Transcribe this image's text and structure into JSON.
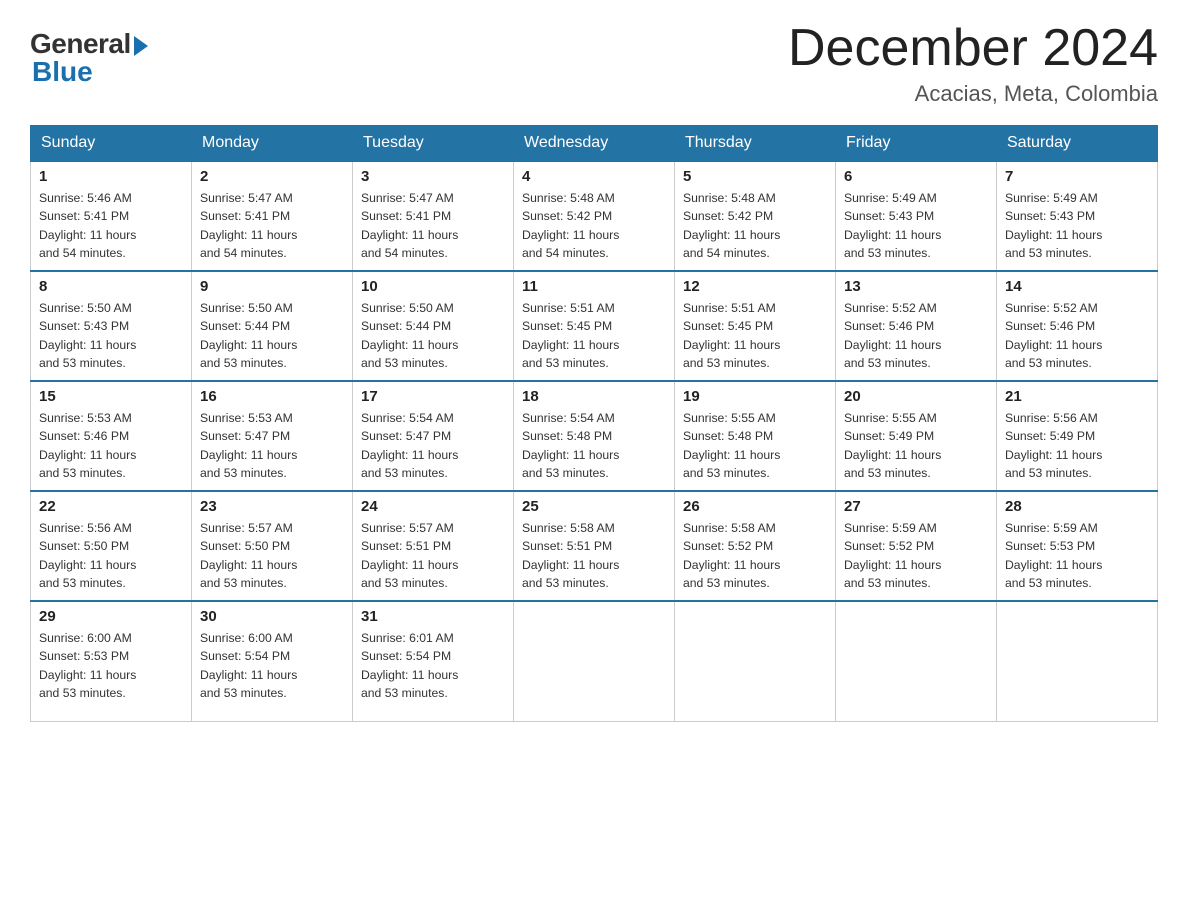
{
  "logo": {
    "general": "General",
    "blue": "Blue"
  },
  "header": {
    "month": "December 2024",
    "location": "Acacias, Meta, Colombia"
  },
  "days_of_week": [
    "Sunday",
    "Monday",
    "Tuesday",
    "Wednesday",
    "Thursday",
    "Friday",
    "Saturday"
  ],
  "weeks": [
    [
      {
        "day": "1",
        "sunrise": "5:46 AM",
        "sunset": "5:41 PM",
        "daylight": "11 hours and 54 minutes."
      },
      {
        "day": "2",
        "sunrise": "5:47 AM",
        "sunset": "5:41 PM",
        "daylight": "11 hours and 54 minutes."
      },
      {
        "day": "3",
        "sunrise": "5:47 AM",
        "sunset": "5:41 PM",
        "daylight": "11 hours and 54 minutes."
      },
      {
        "day": "4",
        "sunrise": "5:48 AM",
        "sunset": "5:42 PM",
        "daylight": "11 hours and 54 minutes."
      },
      {
        "day": "5",
        "sunrise": "5:48 AM",
        "sunset": "5:42 PM",
        "daylight": "11 hours and 54 minutes."
      },
      {
        "day": "6",
        "sunrise": "5:49 AM",
        "sunset": "5:43 PM",
        "daylight": "11 hours and 53 minutes."
      },
      {
        "day": "7",
        "sunrise": "5:49 AM",
        "sunset": "5:43 PM",
        "daylight": "11 hours and 53 minutes."
      }
    ],
    [
      {
        "day": "8",
        "sunrise": "5:50 AM",
        "sunset": "5:43 PM",
        "daylight": "11 hours and 53 minutes."
      },
      {
        "day": "9",
        "sunrise": "5:50 AM",
        "sunset": "5:44 PM",
        "daylight": "11 hours and 53 minutes."
      },
      {
        "day": "10",
        "sunrise": "5:50 AM",
        "sunset": "5:44 PM",
        "daylight": "11 hours and 53 minutes."
      },
      {
        "day": "11",
        "sunrise": "5:51 AM",
        "sunset": "5:45 PM",
        "daylight": "11 hours and 53 minutes."
      },
      {
        "day": "12",
        "sunrise": "5:51 AM",
        "sunset": "5:45 PM",
        "daylight": "11 hours and 53 minutes."
      },
      {
        "day": "13",
        "sunrise": "5:52 AM",
        "sunset": "5:46 PM",
        "daylight": "11 hours and 53 minutes."
      },
      {
        "day": "14",
        "sunrise": "5:52 AM",
        "sunset": "5:46 PM",
        "daylight": "11 hours and 53 minutes."
      }
    ],
    [
      {
        "day": "15",
        "sunrise": "5:53 AM",
        "sunset": "5:46 PM",
        "daylight": "11 hours and 53 minutes."
      },
      {
        "day": "16",
        "sunrise": "5:53 AM",
        "sunset": "5:47 PM",
        "daylight": "11 hours and 53 minutes."
      },
      {
        "day": "17",
        "sunrise": "5:54 AM",
        "sunset": "5:47 PM",
        "daylight": "11 hours and 53 minutes."
      },
      {
        "day": "18",
        "sunrise": "5:54 AM",
        "sunset": "5:48 PM",
        "daylight": "11 hours and 53 minutes."
      },
      {
        "day": "19",
        "sunrise": "5:55 AM",
        "sunset": "5:48 PM",
        "daylight": "11 hours and 53 minutes."
      },
      {
        "day": "20",
        "sunrise": "5:55 AM",
        "sunset": "5:49 PM",
        "daylight": "11 hours and 53 minutes."
      },
      {
        "day": "21",
        "sunrise": "5:56 AM",
        "sunset": "5:49 PM",
        "daylight": "11 hours and 53 minutes."
      }
    ],
    [
      {
        "day": "22",
        "sunrise": "5:56 AM",
        "sunset": "5:50 PM",
        "daylight": "11 hours and 53 minutes."
      },
      {
        "day": "23",
        "sunrise": "5:57 AM",
        "sunset": "5:50 PM",
        "daylight": "11 hours and 53 minutes."
      },
      {
        "day": "24",
        "sunrise": "5:57 AM",
        "sunset": "5:51 PM",
        "daylight": "11 hours and 53 minutes."
      },
      {
        "day": "25",
        "sunrise": "5:58 AM",
        "sunset": "5:51 PM",
        "daylight": "11 hours and 53 minutes."
      },
      {
        "day": "26",
        "sunrise": "5:58 AM",
        "sunset": "5:52 PM",
        "daylight": "11 hours and 53 minutes."
      },
      {
        "day": "27",
        "sunrise": "5:59 AM",
        "sunset": "5:52 PM",
        "daylight": "11 hours and 53 minutes."
      },
      {
        "day": "28",
        "sunrise": "5:59 AM",
        "sunset": "5:53 PM",
        "daylight": "11 hours and 53 minutes."
      }
    ],
    [
      {
        "day": "29",
        "sunrise": "6:00 AM",
        "sunset": "5:53 PM",
        "daylight": "11 hours and 53 minutes."
      },
      {
        "day": "30",
        "sunrise": "6:00 AM",
        "sunset": "5:54 PM",
        "daylight": "11 hours and 53 minutes."
      },
      {
        "day": "31",
        "sunrise": "6:01 AM",
        "sunset": "5:54 PM",
        "daylight": "11 hours and 53 minutes."
      },
      null,
      null,
      null,
      null
    ]
  ]
}
